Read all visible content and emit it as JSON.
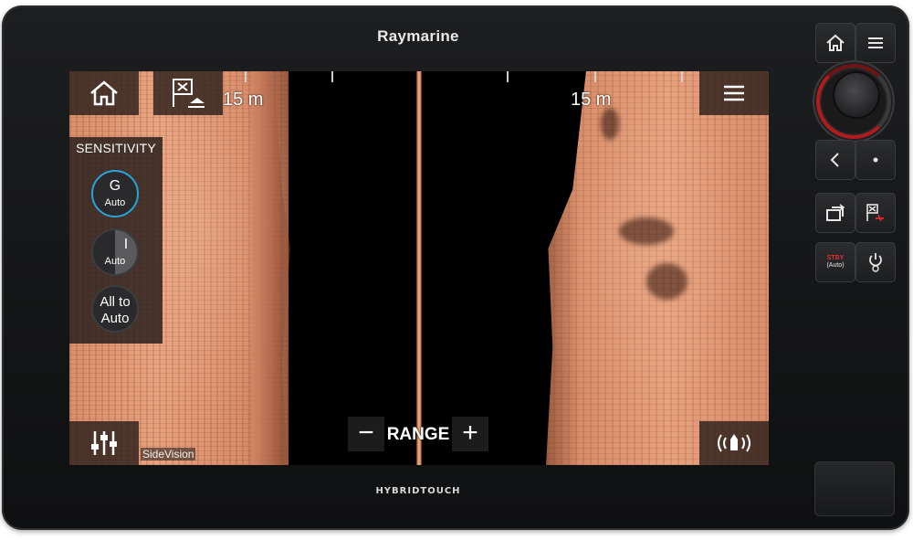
{
  "device": {
    "brand": "Raymarine",
    "model_label": "HYBRIDTOUCH"
  },
  "screen": {
    "range_left": "15 m",
    "range_right": "15 m",
    "mode_label": "SideVision",
    "sensitivity": {
      "title": "SENSITIVITY",
      "gain": {
        "main": "G",
        "sub": "Auto"
      },
      "intensity": {
        "main": "I",
        "sub": "Auto"
      },
      "all_to_auto": {
        "line1": "All to",
        "line2": "Auto"
      }
    },
    "range_control": {
      "minus": "−",
      "label": "RANGE",
      "plus": "+"
    },
    "icons": {
      "home": "home-icon",
      "waypoint": "waypoint-flag-icon",
      "menu": "hamburger-menu-icon",
      "settings": "sliders-icon",
      "transducer": "sonar-transducer-icon"
    }
  },
  "hardware": {
    "stby_label": "STBY",
    "stby_sub": "(Auto)",
    "accent_color": "#b11b1b",
    "active_ring_color": "#29a3d8"
  }
}
